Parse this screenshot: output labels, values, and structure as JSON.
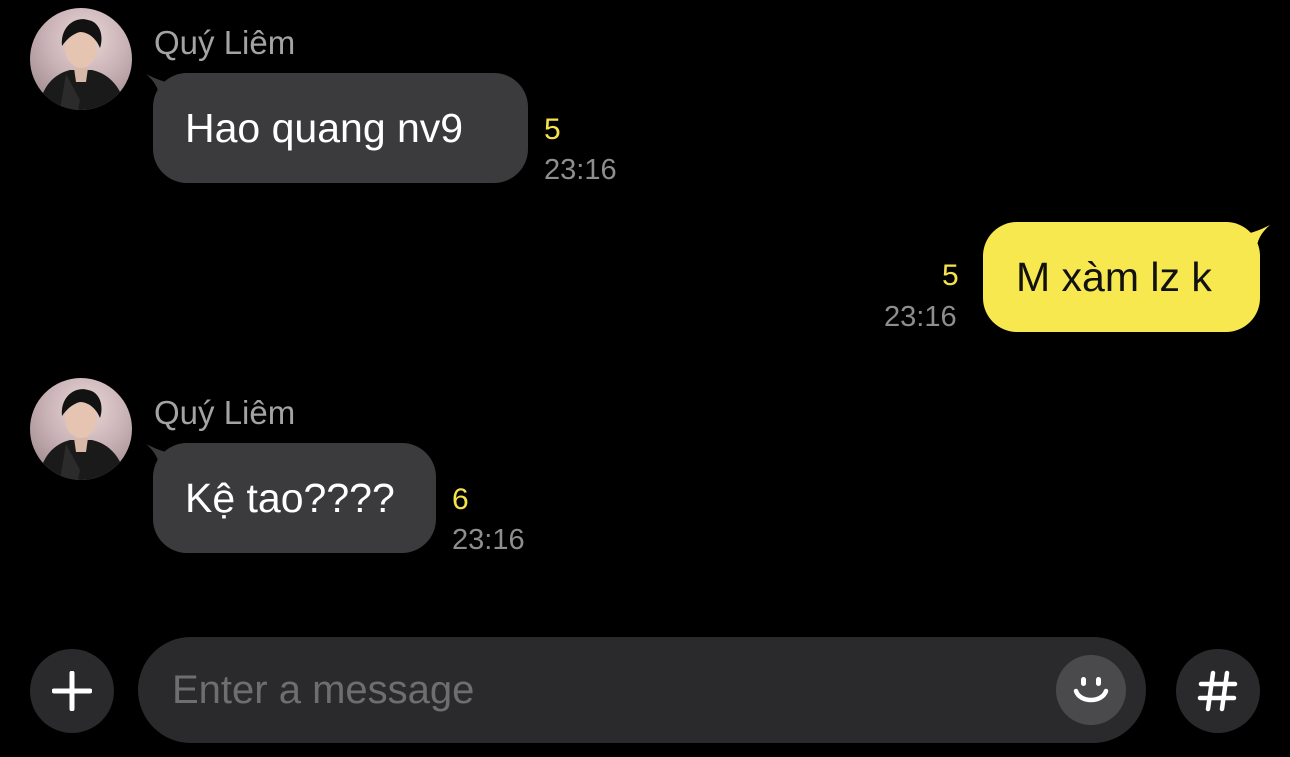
{
  "messages": [
    {
      "sender": "Quý Liêm",
      "text": "Hao quang nv9",
      "unread": "5",
      "time": "23:16",
      "direction": "incoming"
    },
    {
      "text": "M xàm lz k",
      "unread": "5",
      "time": "23:16",
      "direction": "outgoing"
    },
    {
      "sender": "Quý Liêm",
      "text": "Kệ tao????",
      "unread": "6",
      "time": "23:16",
      "direction": "incoming"
    }
  ],
  "composer": {
    "placeholder": "Enter a message",
    "add_icon": "plus-icon",
    "emoji_icon": "smiley-icon",
    "hashtag_icon": "hashtag-icon"
  },
  "colors": {
    "background": "#000000",
    "incoming_bubble": "#3b3b3d",
    "outgoing_bubble": "#f8e84f",
    "unread_count": "#f6e34b",
    "timestamp": "#8e8e8e"
  }
}
